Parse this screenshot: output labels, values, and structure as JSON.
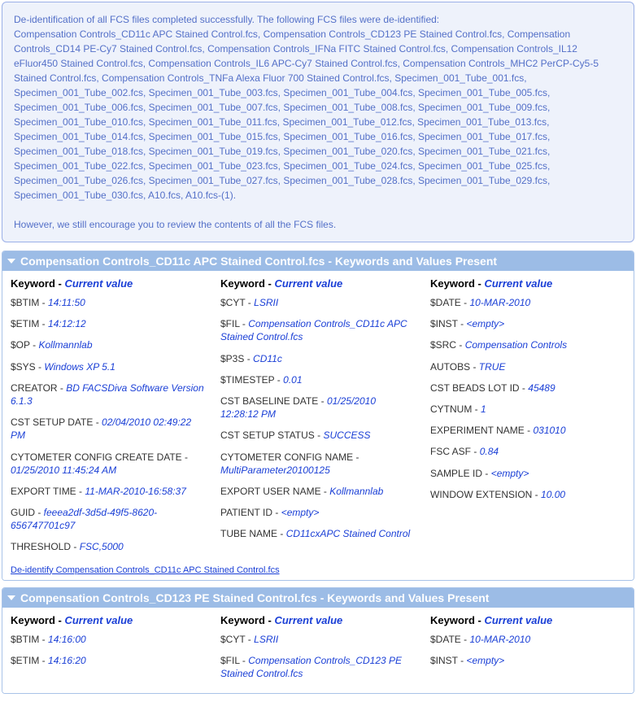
{
  "notice": {
    "intro": "De-identification of all FCS files completed successfully. The following FCS files were de-identified:",
    "files": "Compensation Controls_CD11c APC Stained Control.fcs, Compensation Controls_CD123 PE Stained Control.fcs, Compensation Controls_CD14 PE-Cy7 Stained Control.fcs, Compensation Controls_IFNa FITC Stained Control.fcs, Compensation Controls_IL12 eFluor450 Stained Control.fcs, Compensation Controls_IL6 APC-Cy7 Stained Control.fcs, Compensation Controls_MHC2 PerCP-Cy5-5 Stained Control.fcs, Compensation Controls_TNFa Alexa Fluor 700 Stained Control.fcs, Specimen_001_Tube_001.fcs, Specimen_001_Tube_002.fcs, Specimen_001_Tube_003.fcs, Specimen_001_Tube_004.fcs, Specimen_001_Tube_005.fcs, Specimen_001_Tube_006.fcs, Specimen_001_Tube_007.fcs, Specimen_001_Tube_008.fcs, Specimen_001_Tube_009.fcs, Specimen_001_Tube_010.fcs, Specimen_001_Tube_011.fcs, Specimen_001_Tube_012.fcs, Specimen_001_Tube_013.fcs, Specimen_001_Tube_014.fcs, Specimen_001_Tube_015.fcs, Specimen_001_Tube_016.fcs, Specimen_001_Tube_017.fcs, Specimen_001_Tube_018.fcs, Specimen_001_Tube_019.fcs, Specimen_001_Tube_020.fcs, Specimen_001_Tube_021.fcs, Specimen_001_Tube_022.fcs, Specimen_001_Tube_023.fcs, Specimen_001_Tube_024.fcs, Specimen_001_Tube_025.fcs, Specimen_001_Tube_026.fcs, Specimen_001_Tube_027.fcs, Specimen_001_Tube_028.fcs, Specimen_001_Tube_029.fcs, Specimen_001_Tube_030.fcs, A10.fcs, A10.fcs-(1).",
    "outro": "However, we still encourage you to review the contents of all the FCS files."
  },
  "col_head": {
    "keyword": "Keyword",
    "dash": " - ",
    "current_value": "Current value"
  },
  "panels": [
    {
      "title": "Compensation Controls_CD11c APC Stained Control.fcs - Keywords and Values Present",
      "deid_link": "De-identify Compensation Controls_CD11c APC Stained Control.fcs",
      "cols": [
        [
          {
            "k": "$BTIM",
            "v": "14:11:50"
          },
          {
            "k": "$ETIM",
            "v": "14:12:12"
          },
          {
            "k": "$OP",
            "v": "Kollmannlab"
          },
          {
            "k": "$SYS",
            "v": "Windows XP 5.1"
          },
          {
            "k": "CREATOR",
            "v": "BD FACSDiva Software Version 6.1.3"
          },
          {
            "k": "CST SETUP DATE",
            "v": "02/04/2010 02:49:22 PM"
          },
          {
            "k": "CYTOMETER CONFIG CREATE DATE",
            "v": "01/25/2010 11:45:24 AM"
          },
          {
            "k": "EXPORT TIME",
            "v": "11-MAR-2010-16:58:37"
          },
          {
            "k": "GUID",
            "v": "feeea2df-3d5d-49f5-8620-656747701c97"
          },
          {
            "k": "THRESHOLD",
            "v": "FSC,5000"
          }
        ],
        [
          {
            "k": "$CYT",
            "v": "LSRII"
          },
          {
            "k": "$FIL",
            "v": "Compensation Controls_CD11c APC Stained Control.fcs"
          },
          {
            "k": "$P3S",
            "v": "CD11c"
          },
          {
            "k": "$TIMESTEP",
            "v": "0.01"
          },
          {
            "k": "CST BASELINE DATE",
            "v": "01/25/2010 12:28:12 PM"
          },
          {
            "k": "CST SETUP STATUS",
            "v": "SUCCESS"
          },
          {
            "k": "CYTOMETER CONFIG NAME",
            "v": "MultiParameter20100125"
          },
          {
            "k": "EXPORT USER NAME",
            "v": "Kollmannlab"
          },
          {
            "k": "PATIENT ID",
            "v": "<empty>"
          },
          {
            "k": "TUBE NAME",
            "v": "CD11cxAPC Stained Control"
          }
        ],
        [
          {
            "k": "$DATE",
            "v": "10-MAR-2010"
          },
          {
            "k": "$INST",
            "v": "<empty>"
          },
          {
            "k": "$SRC",
            "v": "Compensation Controls"
          },
          {
            "k": "AUTOBS",
            "v": "TRUE"
          },
          {
            "k": "CST BEADS LOT ID",
            "v": "45489"
          },
          {
            "k": "CYTNUM",
            "v": "1"
          },
          {
            "k": "EXPERIMENT NAME",
            "v": "031010"
          },
          {
            "k": "FSC ASF",
            "v": "0.84"
          },
          {
            "k": "SAMPLE ID",
            "v": "<empty>"
          },
          {
            "k": "WINDOW EXTENSION",
            "v": "10.00"
          }
        ]
      ]
    },
    {
      "title": "Compensation Controls_CD123 PE Stained Control.fcs - Keywords and Values Present",
      "deid_link": "",
      "cols": [
        [
          {
            "k": "$BTIM",
            "v": "14:16:00"
          },
          {
            "k": "$ETIM",
            "v": "14:16:20"
          }
        ],
        [
          {
            "k": "$CYT",
            "v": "LSRII"
          },
          {
            "k": "$FIL",
            "v": "Compensation Controls_CD123 PE Stained Control.fcs"
          }
        ],
        [
          {
            "k": "$DATE",
            "v": "10-MAR-2010"
          },
          {
            "k": "$INST",
            "v": "<empty>"
          }
        ]
      ]
    }
  ]
}
